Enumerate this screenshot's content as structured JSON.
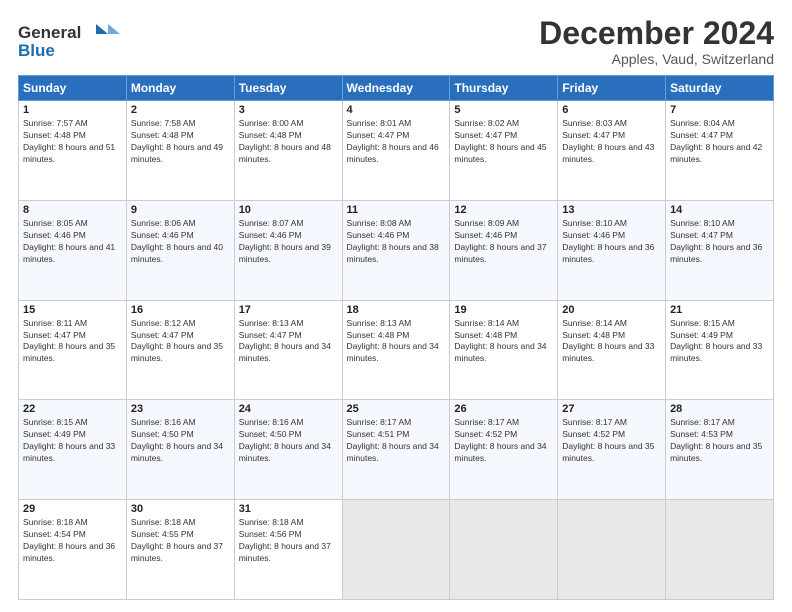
{
  "logo": {
    "general": "General",
    "blue": "Blue"
  },
  "header": {
    "month": "December 2024",
    "location": "Apples, Vaud, Switzerland"
  },
  "weekdays": [
    "Sunday",
    "Monday",
    "Tuesday",
    "Wednesday",
    "Thursday",
    "Friday",
    "Saturday"
  ],
  "weeks": [
    [
      {
        "day": "1",
        "sunrise": "7:57 AM",
        "sunset": "4:48 PM",
        "daylight": "8 hours and 51 minutes."
      },
      {
        "day": "2",
        "sunrise": "7:58 AM",
        "sunset": "4:48 PM",
        "daylight": "8 hours and 49 minutes."
      },
      {
        "day": "3",
        "sunrise": "8:00 AM",
        "sunset": "4:48 PM",
        "daylight": "8 hours and 48 minutes."
      },
      {
        "day": "4",
        "sunrise": "8:01 AM",
        "sunset": "4:47 PM",
        "daylight": "8 hours and 46 minutes."
      },
      {
        "day": "5",
        "sunrise": "8:02 AM",
        "sunset": "4:47 PM",
        "daylight": "8 hours and 45 minutes."
      },
      {
        "day": "6",
        "sunrise": "8:03 AM",
        "sunset": "4:47 PM",
        "daylight": "8 hours and 43 minutes."
      },
      {
        "day": "7",
        "sunrise": "8:04 AM",
        "sunset": "4:47 PM",
        "daylight": "8 hours and 42 minutes."
      }
    ],
    [
      {
        "day": "8",
        "sunrise": "8:05 AM",
        "sunset": "4:46 PM",
        "daylight": "8 hours and 41 minutes."
      },
      {
        "day": "9",
        "sunrise": "8:06 AM",
        "sunset": "4:46 PM",
        "daylight": "8 hours and 40 minutes."
      },
      {
        "day": "10",
        "sunrise": "8:07 AM",
        "sunset": "4:46 PM",
        "daylight": "8 hours and 39 minutes."
      },
      {
        "day": "11",
        "sunrise": "8:08 AM",
        "sunset": "4:46 PM",
        "daylight": "8 hours and 38 minutes."
      },
      {
        "day": "12",
        "sunrise": "8:09 AM",
        "sunset": "4:46 PM",
        "daylight": "8 hours and 37 minutes."
      },
      {
        "day": "13",
        "sunrise": "8:10 AM",
        "sunset": "4:46 PM",
        "daylight": "8 hours and 36 minutes."
      },
      {
        "day": "14",
        "sunrise": "8:10 AM",
        "sunset": "4:47 PM",
        "daylight": "8 hours and 36 minutes."
      }
    ],
    [
      {
        "day": "15",
        "sunrise": "8:11 AM",
        "sunset": "4:47 PM",
        "daylight": "8 hours and 35 minutes."
      },
      {
        "day": "16",
        "sunrise": "8:12 AM",
        "sunset": "4:47 PM",
        "daylight": "8 hours and 35 minutes."
      },
      {
        "day": "17",
        "sunrise": "8:13 AM",
        "sunset": "4:47 PM",
        "daylight": "8 hours and 34 minutes."
      },
      {
        "day": "18",
        "sunrise": "8:13 AM",
        "sunset": "4:48 PM",
        "daylight": "8 hours and 34 minutes."
      },
      {
        "day": "19",
        "sunrise": "8:14 AM",
        "sunset": "4:48 PM",
        "daylight": "8 hours and 34 minutes."
      },
      {
        "day": "20",
        "sunrise": "8:14 AM",
        "sunset": "4:48 PM",
        "daylight": "8 hours and 33 minutes."
      },
      {
        "day": "21",
        "sunrise": "8:15 AM",
        "sunset": "4:49 PM",
        "daylight": "8 hours and 33 minutes."
      }
    ],
    [
      {
        "day": "22",
        "sunrise": "8:15 AM",
        "sunset": "4:49 PM",
        "daylight": "8 hours and 33 minutes."
      },
      {
        "day": "23",
        "sunrise": "8:16 AM",
        "sunset": "4:50 PM",
        "daylight": "8 hours and 34 minutes."
      },
      {
        "day": "24",
        "sunrise": "8:16 AM",
        "sunset": "4:50 PM",
        "daylight": "8 hours and 34 minutes."
      },
      {
        "day": "25",
        "sunrise": "8:17 AM",
        "sunset": "4:51 PM",
        "daylight": "8 hours and 34 minutes."
      },
      {
        "day": "26",
        "sunrise": "8:17 AM",
        "sunset": "4:52 PM",
        "daylight": "8 hours and 34 minutes."
      },
      {
        "day": "27",
        "sunrise": "8:17 AM",
        "sunset": "4:52 PM",
        "daylight": "8 hours and 35 minutes."
      },
      {
        "day": "28",
        "sunrise": "8:17 AM",
        "sunset": "4:53 PM",
        "daylight": "8 hours and 35 minutes."
      }
    ],
    [
      {
        "day": "29",
        "sunrise": "8:18 AM",
        "sunset": "4:54 PM",
        "daylight": "8 hours and 36 minutes."
      },
      {
        "day": "30",
        "sunrise": "8:18 AM",
        "sunset": "4:55 PM",
        "daylight": "8 hours and 37 minutes."
      },
      {
        "day": "31",
        "sunrise": "8:18 AM",
        "sunset": "4:56 PM",
        "daylight": "8 hours and 37 minutes."
      },
      null,
      null,
      null,
      null
    ]
  ]
}
